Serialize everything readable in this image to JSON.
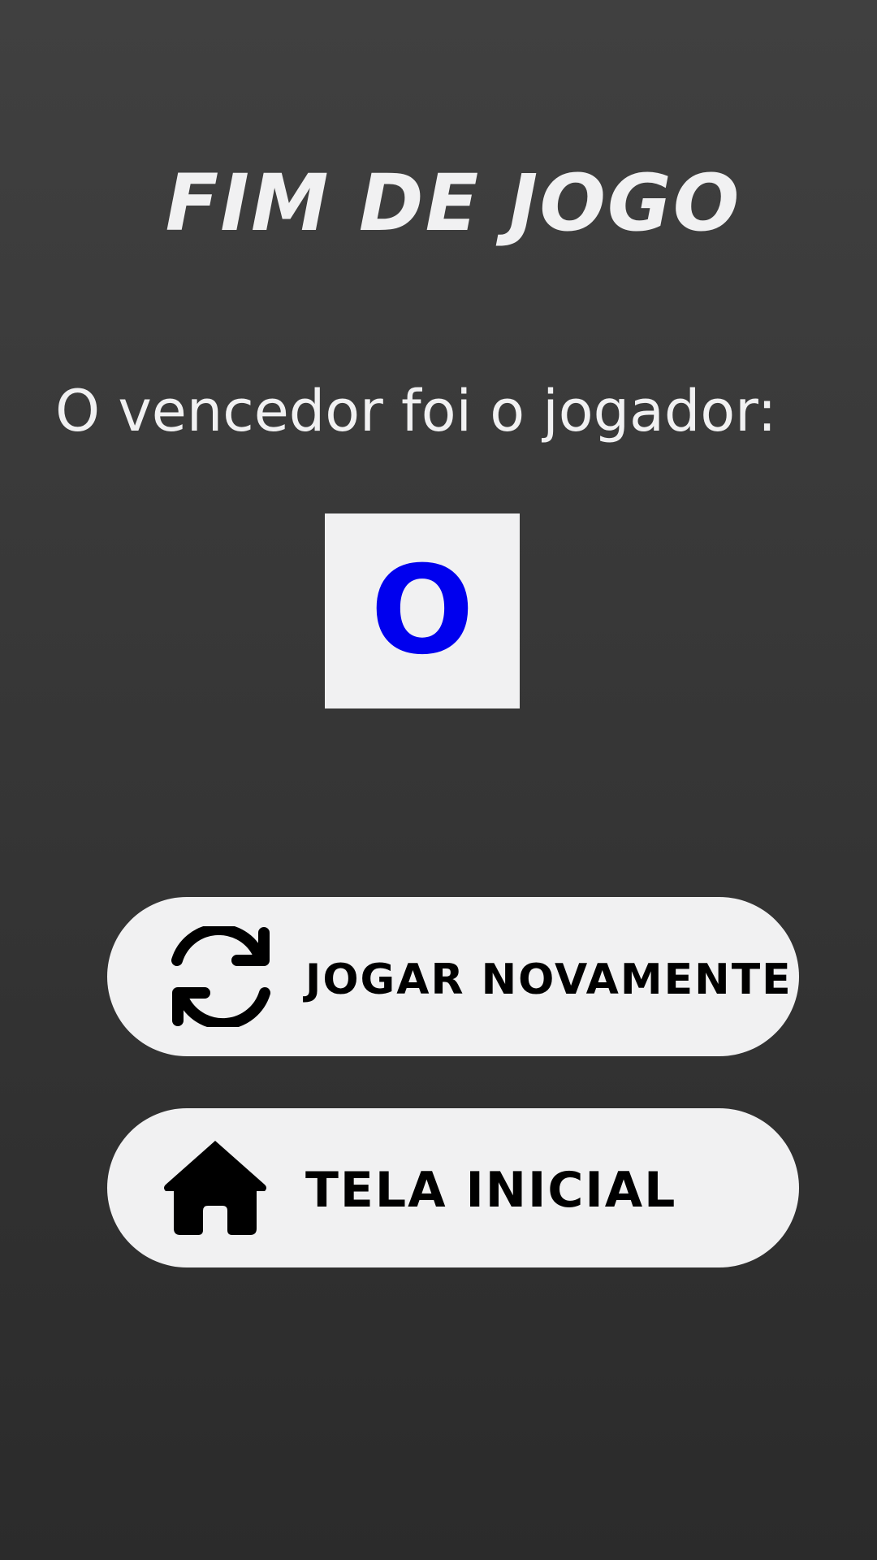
{
  "screen": {
    "title": "FIM DE JOGO",
    "winner_prompt": "O vencedor foi o jogador:",
    "winner_symbol": "O",
    "winner_color": "#0000ee"
  },
  "buttons": {
    "play_again": {
      "label": "JOGAR NOVAMENTE",
      "icon": "refresh-icon"
    },
    "home": {
      "label": "TELA INICIAL",
      "icon": "home-icon"
    }
  },
  "colors": {
    "background_top": "#404040",
    "background_bottom": "#2b2b2b",
    "surface": "#f1f1f2",
    "button_text": "#000000"
  }
}
